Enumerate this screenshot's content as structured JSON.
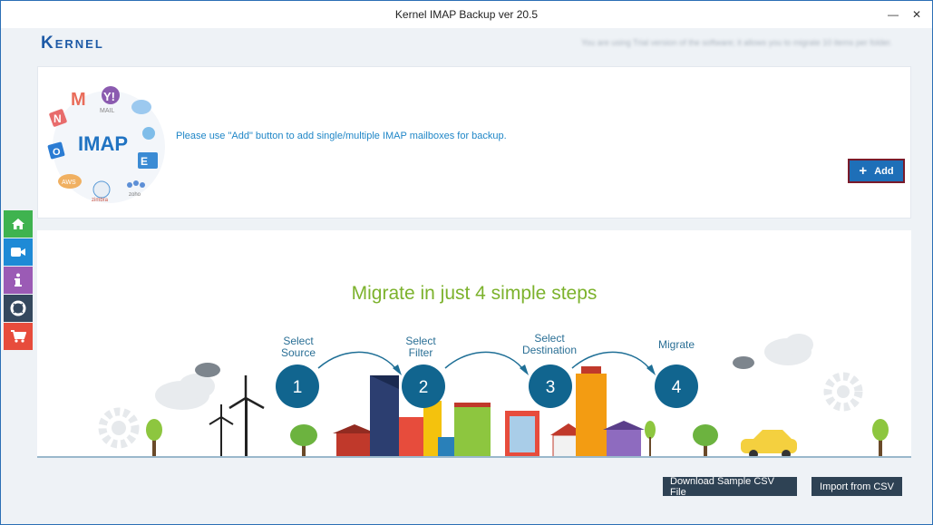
{
  "window": {
    "title": "Kernel IMAP Backup ver 20.5",
    "minimize": "—",
    "close": "✕"
  },
  "header": {
    "logo": "Kernel",
    "trial_notice": "You are using Trial version of the software; it allows you to migrate 10 items per folder."
  },
  "top_panel": {
    "imap_label": "IMAP",
    "message": "Please use \"Add\" button to add single/multiple IMAP mailboxes for backup.",
    "add_label": "Add"
  },
  "steps": {
    "title": "Migrate in just 4 simple steps",
    "items": [
      {
        "number": "1",
        "label_line1": "Select",
        "label_line2": "Source"
      },
      {
        "number": "2",
        "label_line1": "Select",
        "label_line2": "Filter"
      },
      {
        "number": "3",
        "label_line1": "Select",
        "label_line2": "Destination"
      },
      {
        "number": "4",
        "label_line1": "Migrate",
        "label_line2": ""
      }
    ]
  },
  "sidebar": {
    "items": [
      {
        "name": "home",
        "icon": "home-icon"
      },
      {
        "name": "video",
        "icon": "video-camera-icon"
      },
      {
        "name": "info",
        "icon": "info-icon"
      },
      {
        "name": "support",
        "icon": "lifebuoy-icon"
      },
      {
        "name": "cart",
        "icon": "shopping-cart-icon"
      }
    ]
  },
  "footer": {
    "download_csv": "Download Sample CSV File",
    "import_csv": "Import from CSV"
  },
  "colors": {
    "accent": "#1e6fb8",
    "steps_green": "#7cb22c",
    "step_circle": "#11658f",
    "dark_button": "#2e4254"
  }
}
